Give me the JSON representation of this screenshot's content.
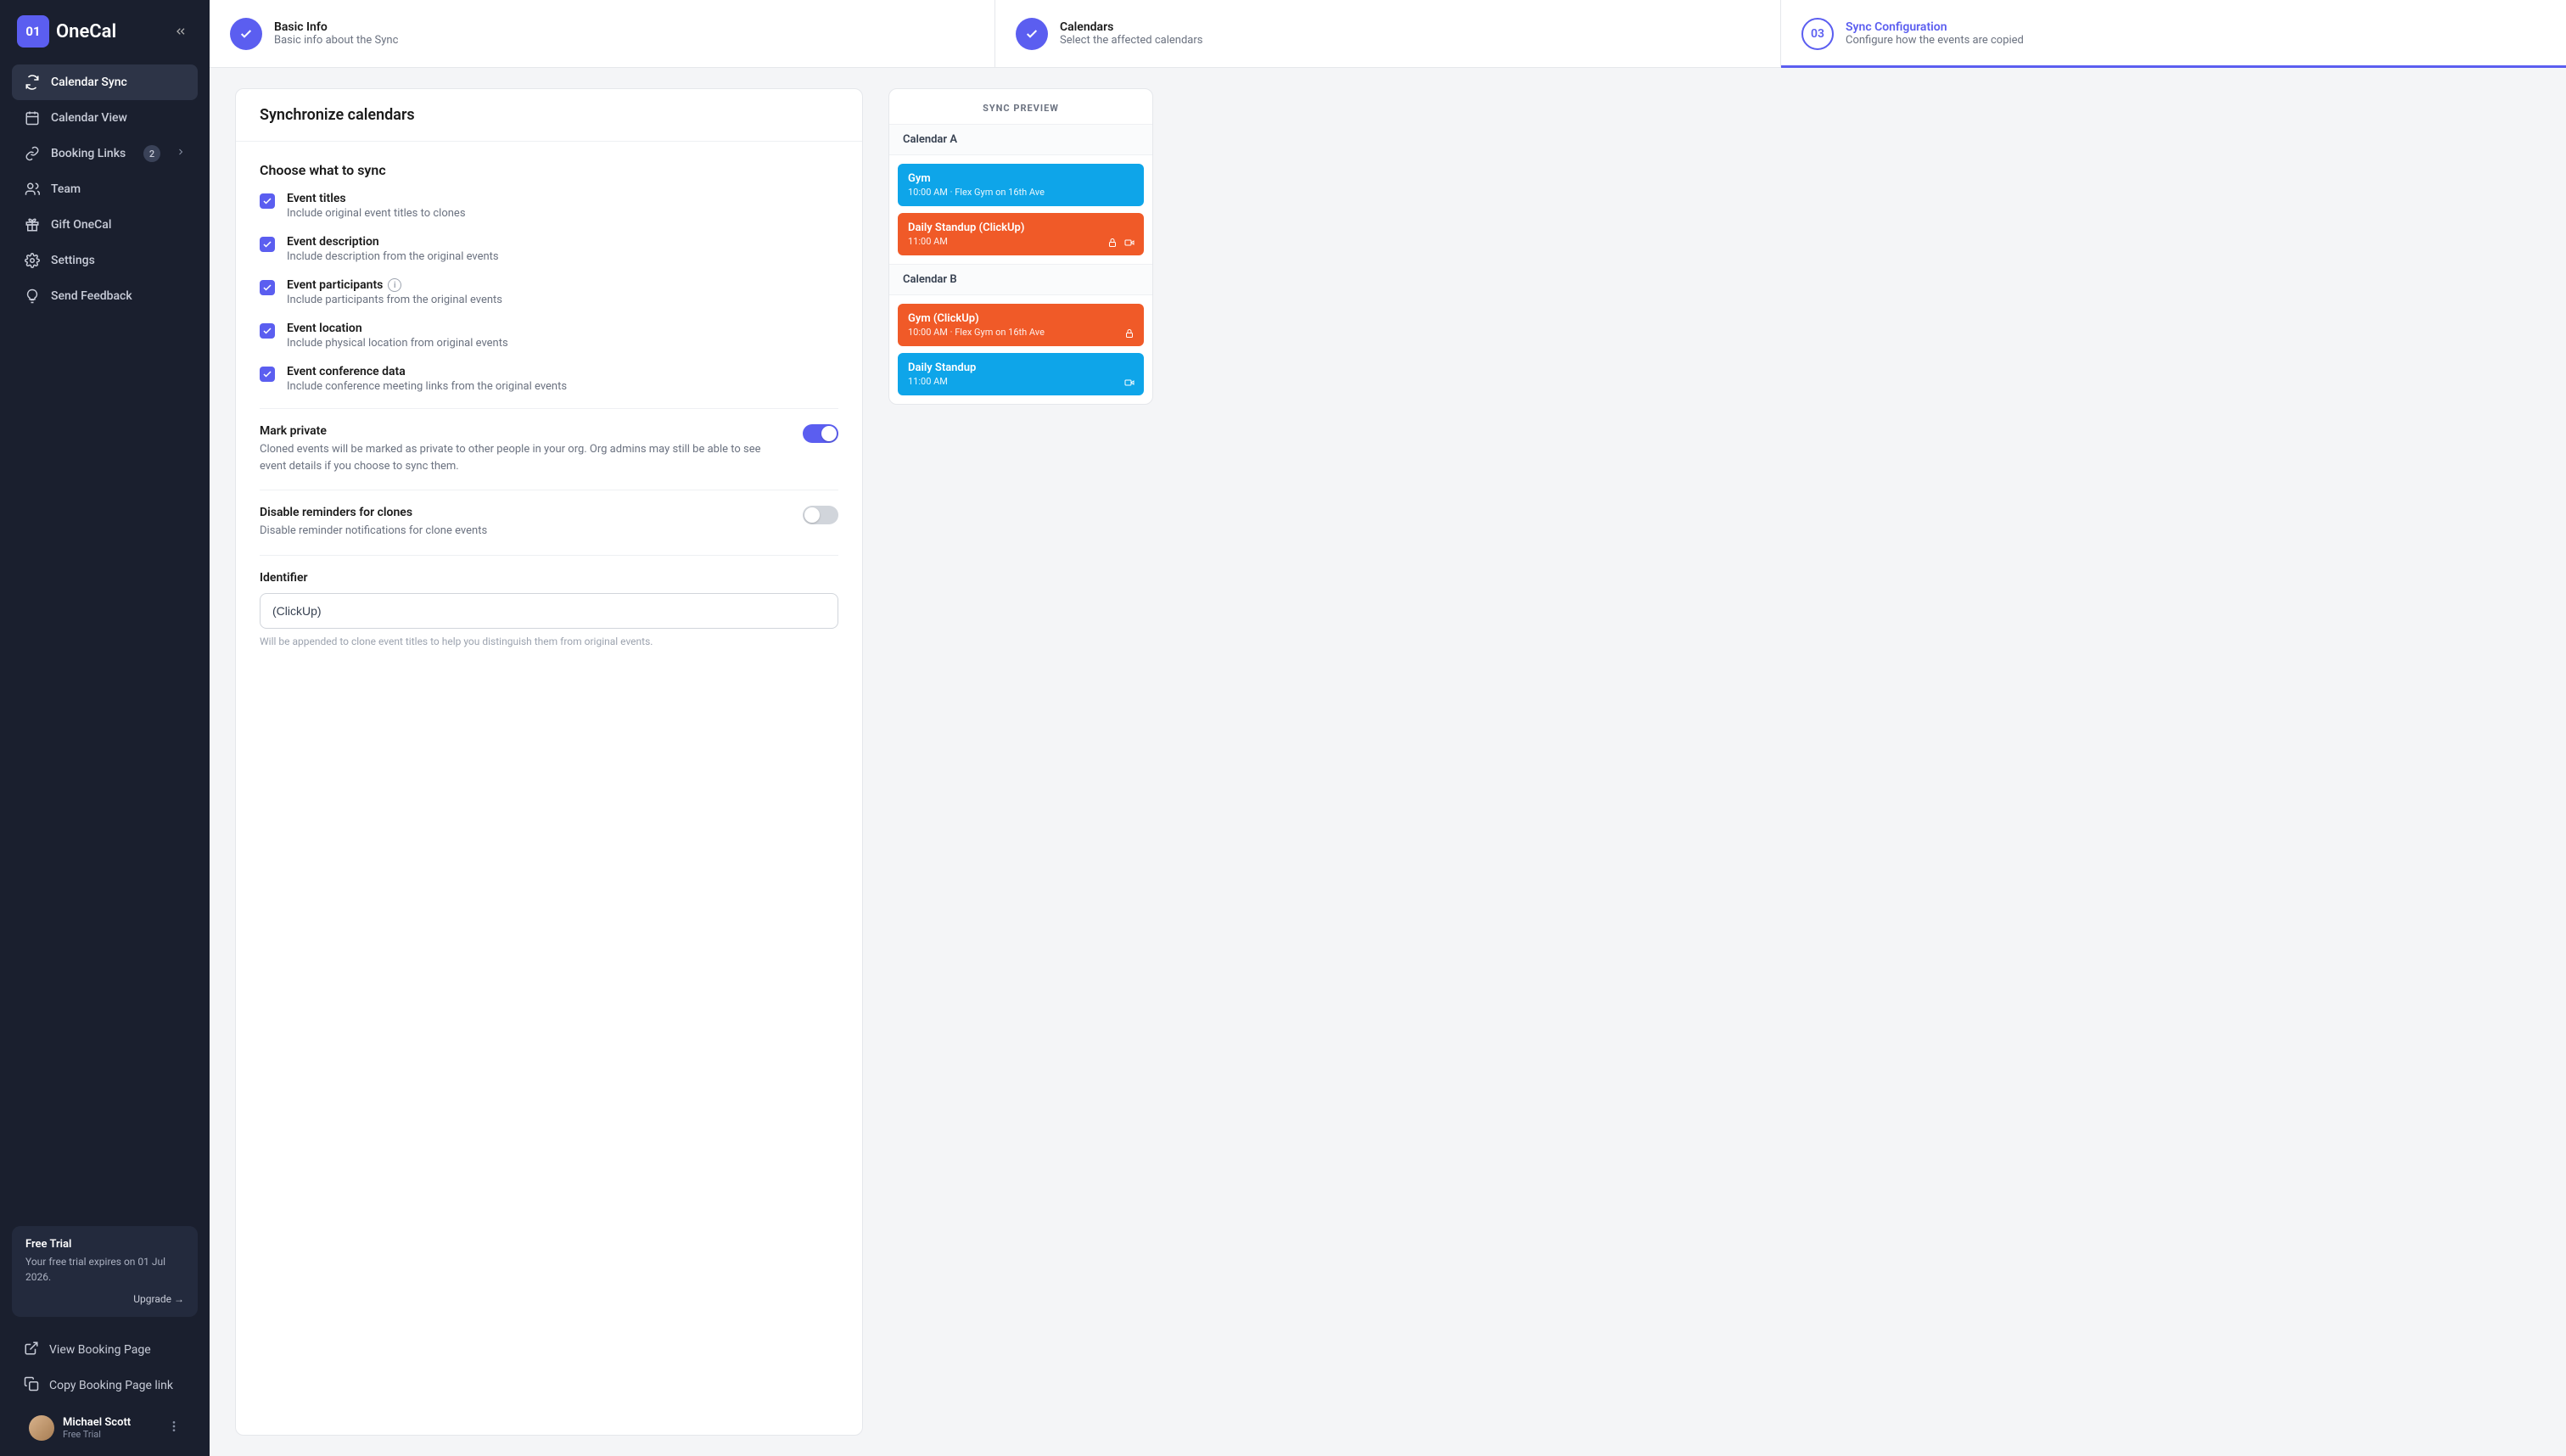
{
  "brand": {
    "icon_text": "01",
    "name": "OneCal"
  },
  "sidebar": {
    "items": [
      {
        "label": "Calendar Sync",
        "icon": "sync-icon",
        "active": true
      },
      {
        "label": "Calendar View",
        "icon": "calendar-icon"
      },
      {
        "label": "Booking Links",
        "icon": "link-icon",
        "badge": "2",
        "chevron": true
      },
      {
        "label": "Team",
        "icon": "team-icon"
      },
      {
        "label": "Gift OneCal",
        "icon": "gift-icon"
      },
      {
        "label": "Settings",
        "icon": "gear-icon"
      },
      {
        "label": "Send Feedback",
        "icon": "bulb-icon"
      }
    ],
    "trial": {
      "title": "Free Trial",
      "sub": "Your free trial expires on 01 Jul 2026.",
      "upgrade": "Upgrade →"
    },
    "links": [
      {
        "label": "View Booking Page",
        "icon": "external-icon"
      },
      {
        "label": "Copy Booking Page link",
        "icon": "copy-icon"
      }
    ],
    "user": {
      "name": "Michael Scott",
      "plan": "Free Trial"
    }
  },
  "stepper": [
    {
      "num": "✓",
      "title": "Basic Info",
      "sub": "Basic info about the Sync",
      "state": "done"
    },
    {
      "num": "✓",
      "title": "Calendars",
      "sub": "Select the affected calendars",
      "state": "done"
    },
    {
      "num": "03",
      "title": "Sync Configuration",
      "sub": "Configure how the events are copied",
      "state": "current"
    }
  ],
  "sync": {
    "heading": "Synchronize calendars",
    "choose_title": "Choose what to sync",
    "checks": [
      {
        "label": "Event titles",
        "sub": "Include original event titles to clones"
      },
      {
        "label": "Event description",
        "sub": "Include description from the original events"
      },
      {
        "label": "Event participants",
        "sub": "Include participants from the original events",
        "info": true
      },
      {
        "label": "Event location",
        "sub": "Include physical location from original events"
      },
      {
        "label": "Event conference data",
        "sub": "Include conference meeting links from the original events"
      }
    ],
    "mark_private": {
      "title": "Mark private",
      "sub": "Cloned events will be marked as private to other people in your org. Org admins may still be able to see event details if you choose to sync them.",
      "on": true
    },
    "disable_reminders": {
      "title": "Disable reminders for clones",
      "sub": "Disable reminder notifications for clone events",
      "on": false
    },
    "identifier": {
      "label": "Identifier",
      "value": "(ClickUp)",
      "hint": "Will be appended to clone event titles to help you distinguish them from original events."
    }
  },
  "preview": {
    "heading": "SYNC PREVIEW",
    "cal_a": "Calendar A",
    "cal_b": "Calendar B",
    "a_events": [
      {
        "title": "Gym",
        "sub": "10:00 AM · Flex Gym on 16th Ave",
        "color": "blue"
      },
      {
        "title": "Daily Standup (ClickUp)",
        "sub": "11:00 AM",
        "color": "orange",
        "lock": true,
        "video": true
      }
    ],
    "b_events": [
      {
        "title": "Gym (ClickUp)",
        "sub": "10:00 AM · Flex Gym on 16th Ave",
        "color": "orange",
        "lock": true
      },
      {
        "title": "Daily Standup",
        "sub": "11:00 AM",
        "color": "blue",
        "video": true
      }
    ]
  }
}
